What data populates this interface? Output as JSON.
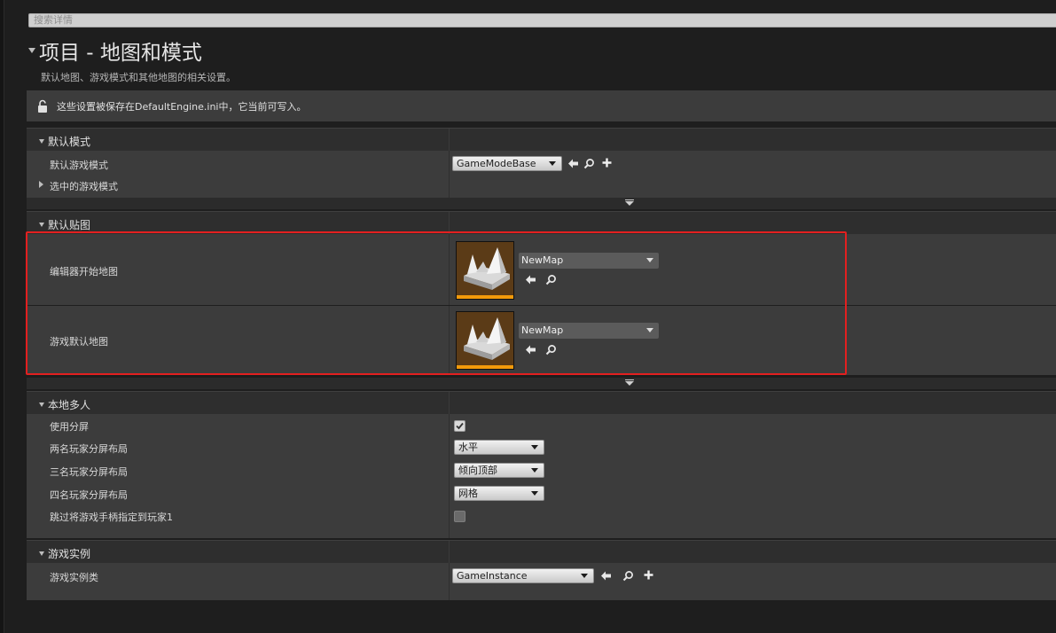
{
  "search": {
    "placeholder": "搜索详情"
  },
  "page": {
    "title": "项目 - 地图和模式",
    "description": "默认地图、游戏模式和其他地图的相关设置。",
    "notice": "这些设置被保存在DefaultEngine.ini中，它当前可写入。"
  },
  "default_modes": {
    "header": "默认模式",
    "game_mode_label": "默认游戏模式",
    "game_mode_value": "GameModeBase",
    "selected_mode_label": "选中的游戏模式"
  },
  "default_maps": {
    "header": "默认贴图",
    "editor_start_map_label": "编辑器开始地图",
    "editor_start_map_value": "NewMap",
    "game_default_map_label": "游戏默认地图",
    "game_default_map_value": "NewMap"
  },
  "local_multiplayer": {
    "header": "本地多人",
    "use_splitscreen_label": "使用分屏",
    "use_splitscreen_checked": true,
    "two_player_label": "两名玩家分屏布局",
    "two_player_value": "水平",
    "three_player_label": "三名玩家分屏布局",
    "three_player_value": "倾向顶部",
    "four_player_label": "四名玩家分屏布局",
    "four_player_value": "网格",
    "skip_gamepad_label": "跳过将游戏手柄指定到玩家1",
    "skip_gamepad_checked": false
  },
  "game_instance": {
    "header": "游戏实例",
    "class_label": "游戏实例类",
    "class_value": "GameInstance"
  },
  "icons": {
    "browse": "arrow-left-icon",
    "find": "magnifier-icon",
    "add": "plus-icon",
    "lock": "lock-icon"
  },
  "colors": {
    "highlight": "#e32020",
    "thumb_accent": "#f39a0a"
  }
}
